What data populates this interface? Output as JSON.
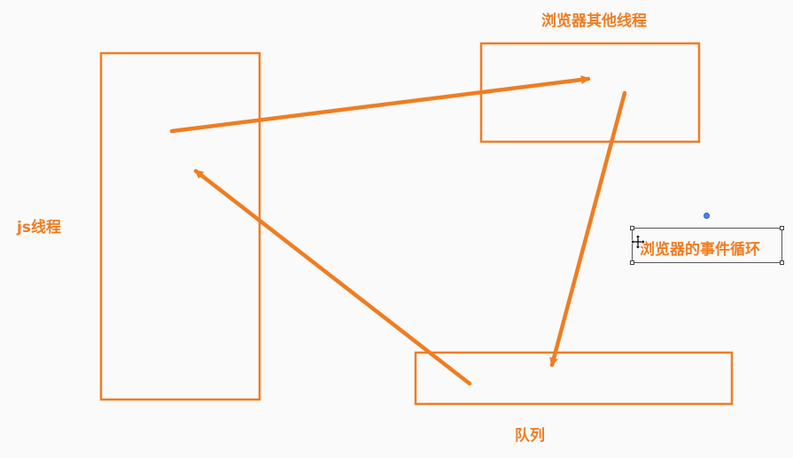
{
  "labels": {
    "js_thread": "js线程",
    "browser_other_threads": "浏览器其他线程",
    "queue": "队列",
    "event_loop": "浏览器的事件循环"
  },
  "colors": {
    "accent": "#ef7d22",
    "background": "#fafafa",
    "selection_border": "#555555",
    "rotate_handle": "#4a86e8"
  },
  "icons": {
    "move": "move-cursor-icon",
    "rotate": "rotate-handle-icon"
  }
}
